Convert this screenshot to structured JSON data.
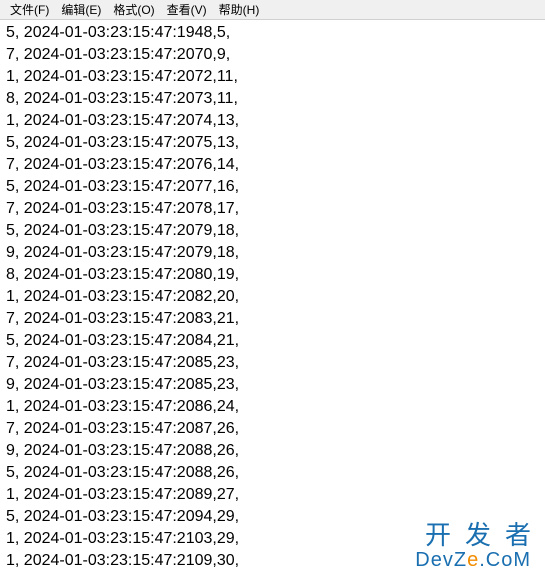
{
  "menu": {
    "file": "文件(F)",
    "edit": "编辑(E)",
    "format": "格式(O)",
    "view": "查看(V)",
    "help": "帮助(H)"
  },
  "lines": [
    "5, 2024-01-03:23:15:47:1948,5,",
    "7, 2024-01-03:23:15:47:2070,9,",
    "1, 2024-01-03:23:15:47:2072,11,",
    "8, 2024-01-03:23:15:47:2073,11,",
    "1, 2024-01-03:23:15:47:2074,13,",
    "5, 2024-01-03:23:15:47:2075,13,",
    "7, 2024-01-03:23:15:47:2076,14,",
    "5, 2024-01-03:23:15:47:2077,16,",
    "7, 2024-01-03:23:15:47:2078,17,",
    "5, 2024-01-03:23:15:47:2079,18,",
    "9, 2024-01-03:23:15:47:2079,18,",
    "8, 2024-01-03:23:15:47:2080,19,",
    "1, 2024-01-03:23:15:47:2082,20,",
    "7, 2024-01-03:23:15:47:2083,21,",
    "5, 2024-01-03:23:15:47:2084,21,",
    "7, 2024-01-03:23:15:47:2085,23,",
    "9, 2024-01-03:23:15:47:2085,23,",
    "1, 2024-01-03:23:15:47:2086,24,",
    "7, 2024-01-03:23:15:47:2087,26,",
    "9, 2024-01-03:23:15:47:2088,26,",
    "5, 2024-01-03:23:15:47:2088,26,",
    "1, 2024-01-03:23:15:47:2089,27,",
    "5, 2024-01-03:23:15:47:2094,29,",
    "1, 2024-01-03:23:15:47:2103,29,",
    "1, 2024-01-03:23:15:47:2109,30,"
  ],
  "watermark": {
    "top": "开发者",
    "bottom_pre": "DevZ",
    "bottom_accent": "e",
    "bottom_post": ".CoM"
  }
}
